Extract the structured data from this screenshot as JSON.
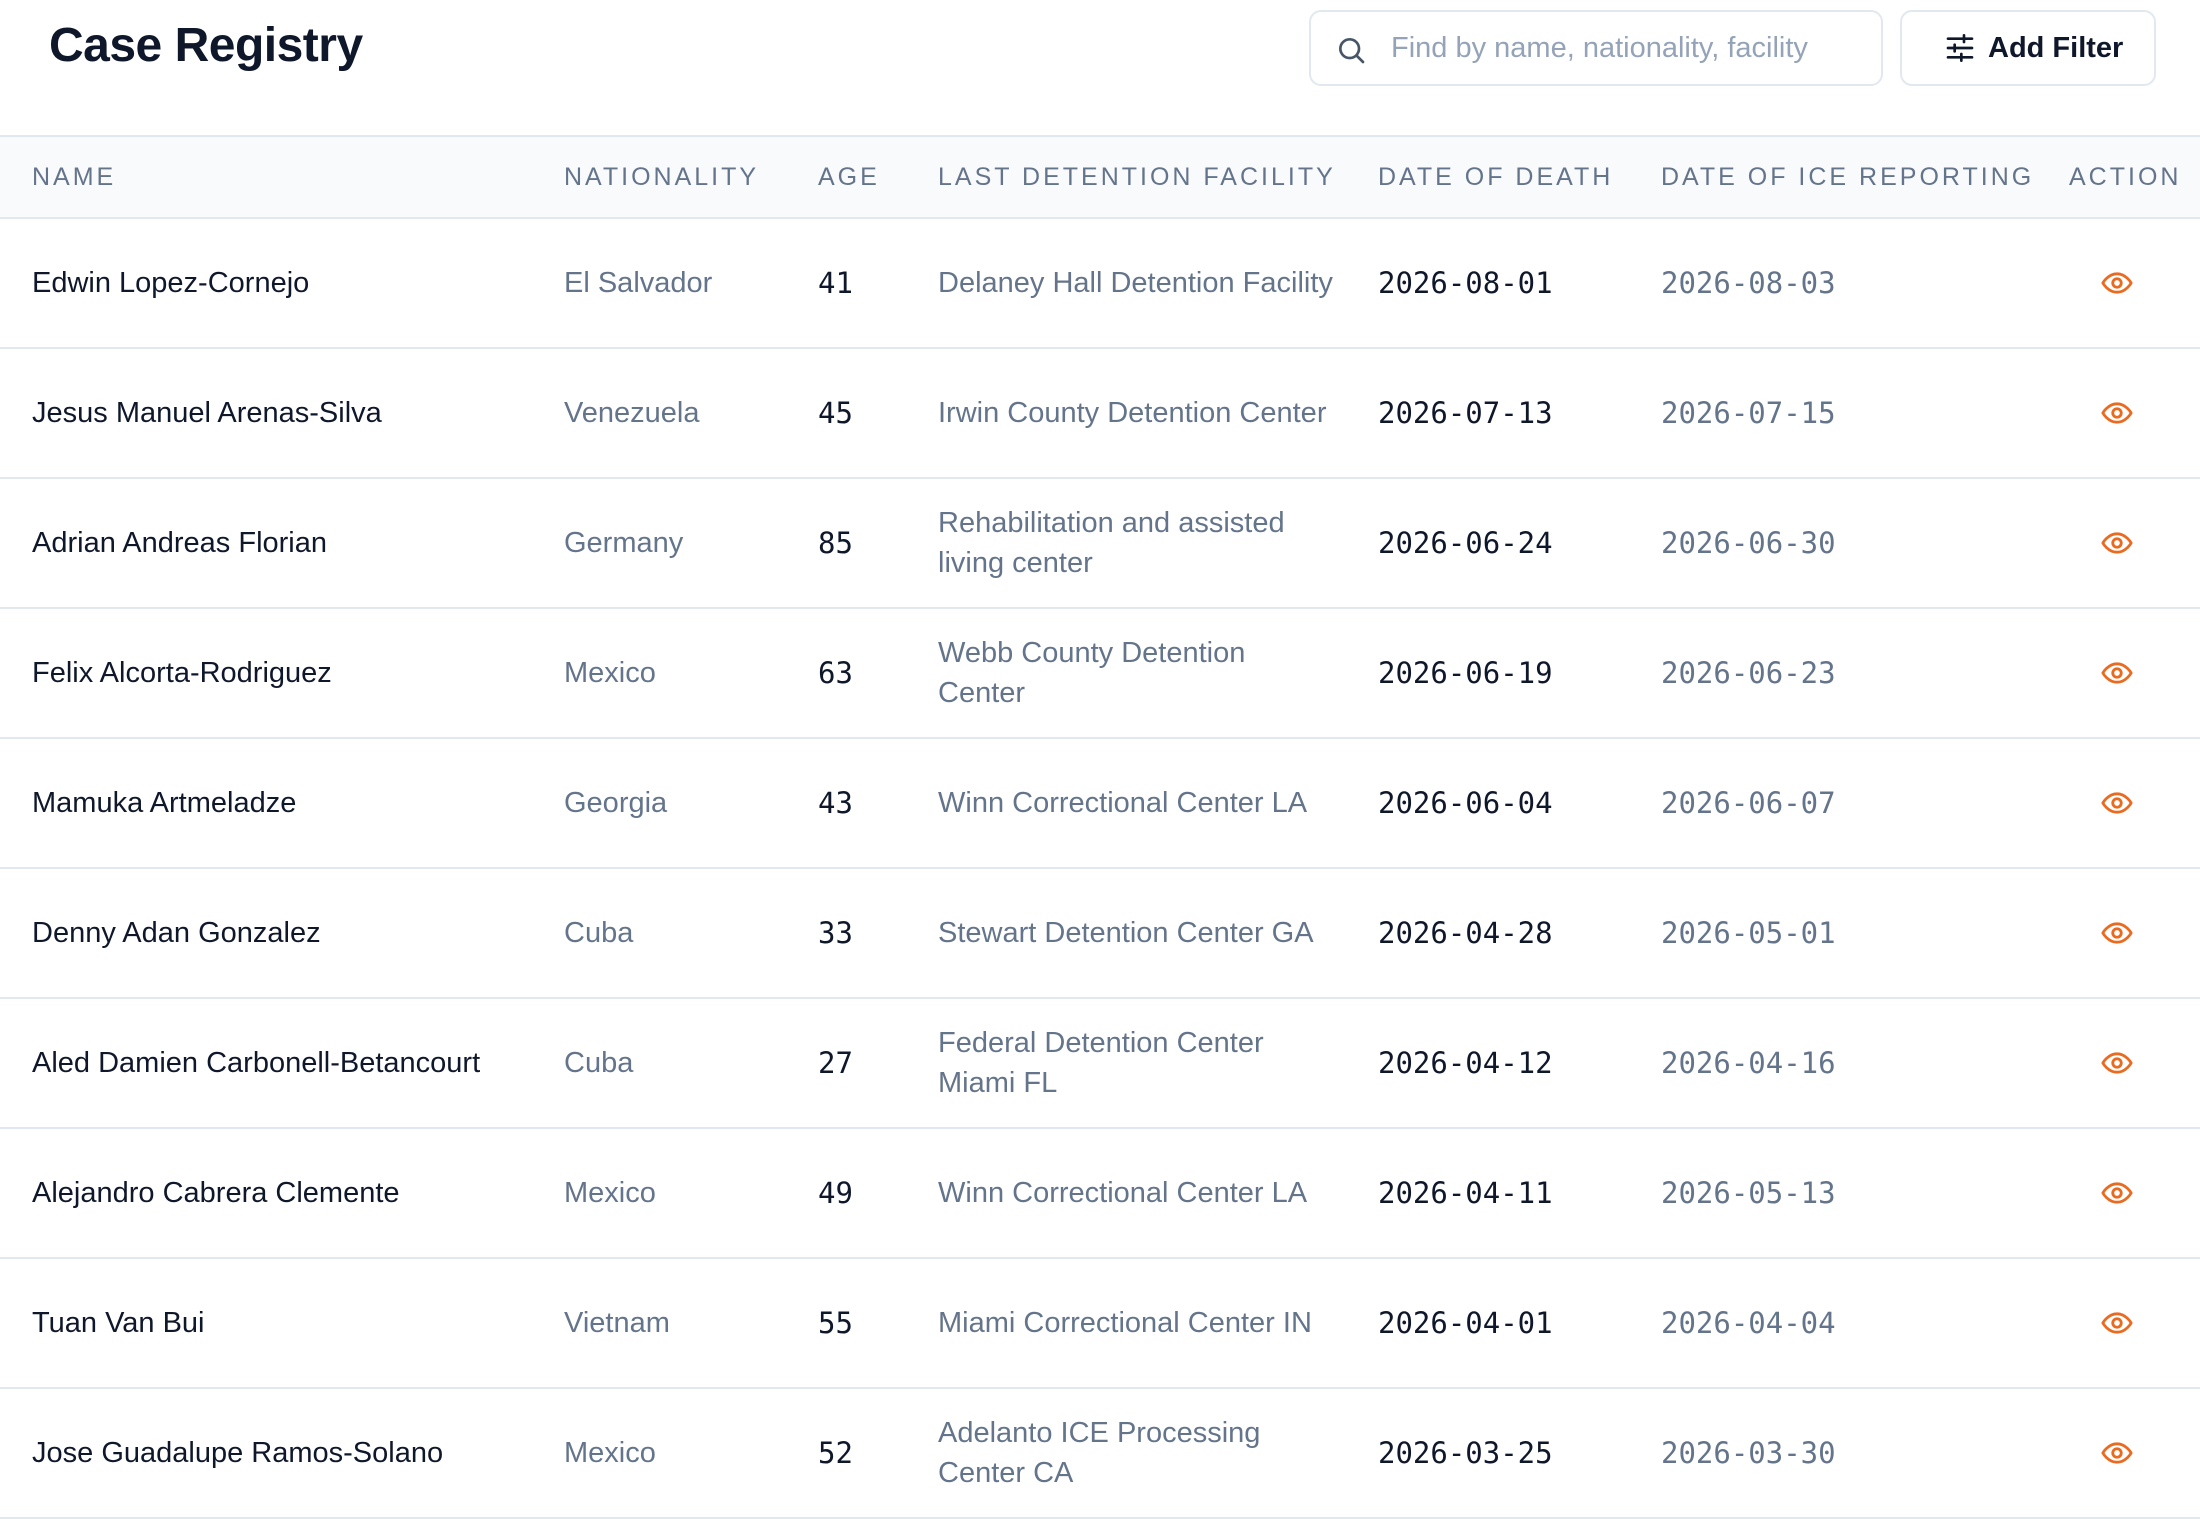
{
  "header": {
    "title": "Case Registry",
    "search_placeholder": "Find by name, nationality, facility",
    "filter_label": "Add Filter"
  },
  "table": {
    "columns": [
      "NAME",
      "NATIONALITY",
      "AGE",
      "LAST DETENTION FACILITY",
      "DATE OF DEATH",
      "DATE OF ICE REPORTING",
      "ACTION"
    ],
    "rows": [
      {
        "name": "Edwin Lopez-Cornejo",
        "nationality": "El Salvador",
        "age": "41",
        "facility": "Delaney Hall Detention Facility",
        "death": "2026-08-01",
        "reported": "2026-08-03"
      },
      {
        "name": "Jesus Manuel Arenas-Silva",
        "nationality": "Venezuela",
        "age": "45",
        "facility": "Irwin County Detention Center",
        "death": "2026-07-13",
        "reported": "2026-07-15"
      },
      {
        "name": "Adrian Andreas Florian",
        "nationality": "Germany",
        "age": "85",
        "facility": "Rehabilitation and assisted living center",
        "death": "2026-06-24",
        "reported": "2026-06-30"
      },
      {
        "name": "Felix Alcorta-Rodriguez",
        "nationality": "Mexico",
        "age": "63",
        "facility": "Webb County Detention Center",
        "death": "2026-06-19",
        "reported": "2026-06-23"
      },
      {
        "name": "Mamuka Artmeladze",
        "nationality": "Georgia",
        "age": "43",
        "facility": "Winn Correctional Center LA",
        "death": "2026-06-04",
        "reported": "2026-06-07"
      },
      {
        "name": "Denny Adan Gonzalez",
        "nationality": "Cuba",
        "age": "33",
        "facility": "Stewart Detention Center GA",
        "death": "2026-04-28",
        "reported": "2026-05-01"
      },
      {
        "name": "Aled Damien Carbonell-Betancourt",
        "nationality": "Cuba",
        "age": "27",
        "facility": "Federal Detention Center Miami FL",
        "death": "2026-04-12",
        "reported": "2026-04-16"
      },
      {
        "name": "Alejandro Cabrera Clemente",
        "nationality": "Mexico",
        "age": "49",
        "facility": "Winn Correctional Center LA",
        "death": "2026-04-11",
        "reported": "2026-05-13"
      },
      {
        "name": "Tuan Van Bui",
        "nationality": "Vietnam",
        "age": "55",
        "facility": "Miami Correctional Center IN",
        "death": "2026-04-01",
        "reported": "2026-04-04"
      },
      {
        "name": "Jose Guadalupe Ramos-Solano",
        "nationality": "Mexico",
        "age": "52",
        "facility": "Adelanto ICE Processing Center CA",
        "death": "2026-03-25",
        "reported": "2026-03-30"
      }
    ]
  },
  "icons": {
    "search": "search-icon",
    "filter": "sliders-icon",
    "view": "eye-icon"
  },
  "colors": {
    "accent": "#ea6a1f",
    "text_primary": "#0f172a",
    "text_muted": "#64748b",
    "border": "#e2e8f0",
    "header_bg": "#f8fafc"
  }
}
